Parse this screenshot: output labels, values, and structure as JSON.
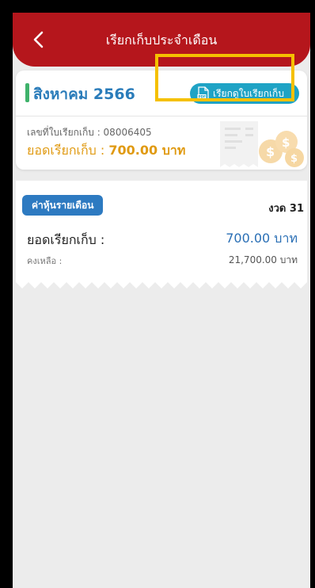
{
  "header": {
    "title": "เรียกเก็บประจำเดือน",
    "back_icon": "chevron-left-icon"
  },
  "bill_card": {
    "month": "สิงหาคม 2566",
    "view_button_label": "เรียกดูใบเรียกเก็บ",
    "view_button_icon": "pdf-icon",
    "bill_number_label": "เลขที่ใบเรียกเก็บ : 08006405",
    "total_label": "ยอดเรียกเก็บ : ",
    "total_amount": "700.00",
    "total_unit": " บาท"
  },
  "receipt": {
    "category": "ค่าหุ้นรายเดือน",
    "installment": "งวด 31",
    "amount_label": "ยอดเรียกเก็บ :",
    "amount_value": "700.00 บาท",
    "balance_label": "คงเหลือ :",
    "balance_value": "21,700.00 บาท"
  },
  "colors": {
    "header": "#b5161c",
    "month_text": "#2a7cba",
    "button": "#1fa3c5",
    "total_text": "#e09a12",
    "badge": "#2d7ac1",
    "highlight": "#f5c000"
  }
}
